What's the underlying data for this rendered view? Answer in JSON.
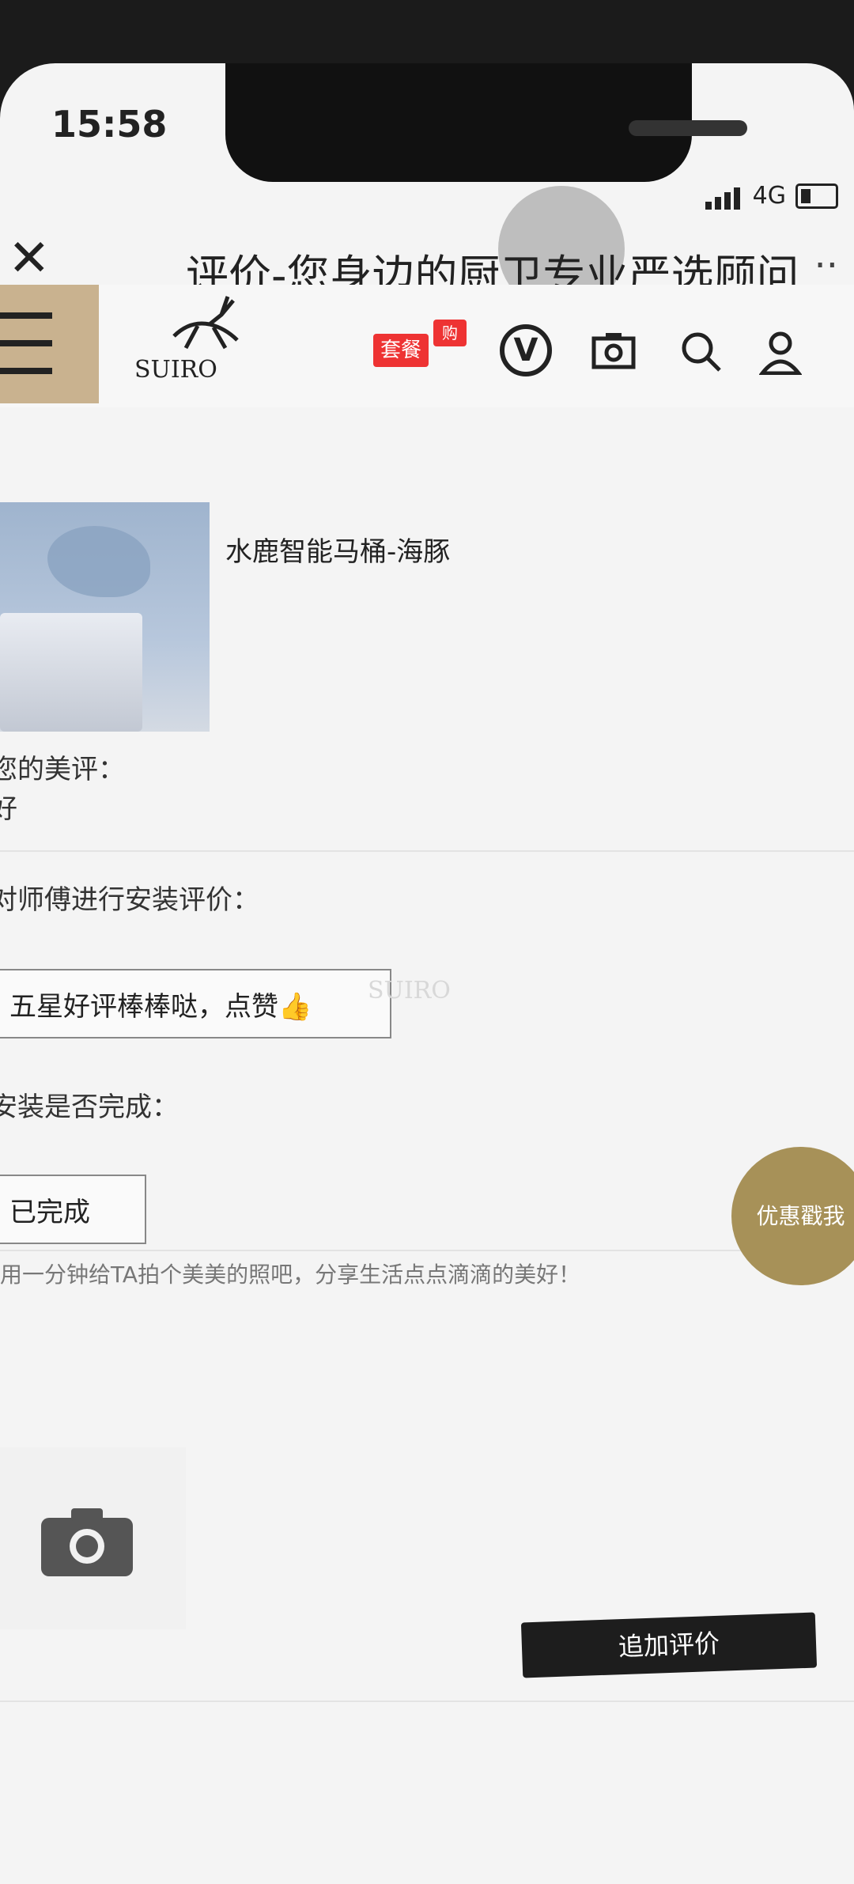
{
  "status_bar": {
    "time": "15:58",
    "network": "4G"
  },
  "titlebar": {
    "title": "评价-您身边的厨卫专业严选顾问"
  },
  "navbar": {
    "logo_text": "SUIRO",
    "promo_label": "套餐",
    "promo_sub": "购",
    "v_label": "V"
  },
  "product": {
    "name": "水鹿智能马桶-海豚"
  },
  "review": {
    "praise_label": "您的美评：",
    "praise_value": "好",
    "install_review_label": "对师傅进行安装评价：",
    "install_review_value": "五星好评棒棒哒，点赞👍",
    "install_done_label": "安装是否完成：",
    "install_done_value": "已完成",
    "photo_hint": "用一分钟给TA拍个美美的照吧，分享生活点点滴滴的美好！"
  },
  "actions": {
    "add_review": "追加评价",
    "coupon": "优惠戳我"
  },
  "watermark": "SUIRO",
  "icons": [
    "close-icon",
    "more-icon",
    "menu-icon",
    "vip-icon",
    "camera-icon",
    "search-icon",
    "user-icon",
    "photo-upload-icon"
  ]
}
